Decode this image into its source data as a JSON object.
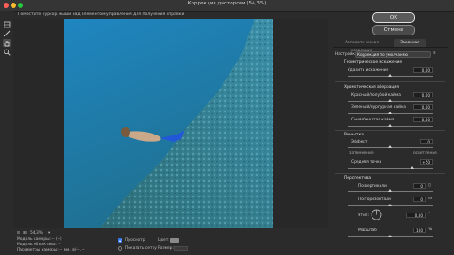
{
  "window": {
    "title": "Коррекция дисторсии (54,3%)"
  },
  "hint": "Поместите курсор мыши над элементом управления для получения справки",
  "buttons": {
    "ok": "ОК",
    "cancel": "Отмена"
  },
  "tabs": [
    {
      "label": "Автоматическая коррекция",
      "active": false
    },
    {
      "label": "Заказная",
      "active": true
    }
  ],
  "settings": {
    "label": "Настройки:",
    "value": "Коррекция по умолчанию"
  },
  "geometric": {
    "section": "Геометрическое искажение",
    "remove_distortion_label": "Удалить искажение",
    "remove_distortion_value": "0,00"
  },
  "chromatic": {
    "section": "Хроматическая аберрация",
    "items": [
      {
        "label": "Красный/голубой кайма",
        "value": "0,00"
      },
      {
        "label": "Зеленый/пурпурная кайма",
        "value": "0,00"
      },
      {
        "label": "Синяя/желтая кайма",
        "value": "0,00"
      }
    ]
  },
  "vignette": {
    "section": "Виньетка",
    "amount_label": "Эффект",
    "amount_value": "0",
    "darken_label": "затемнение",
    "lighten_label": "осветление",
    "midpoint_label": "Средняя точка",
    "midpoint_value": "+50"
  },
  "perspective": {
    "section": "Перспектива",
    "vertical_label": "По вертикали",
    "vertical_value": "0",
    "horizontal_label": "По горизонтали",
    "horizontal_value": "0",
    "angle_label": "Угол:",
    "angle_value": "0,00",
    "scale_label": "Масштаб",
    "scale_value": "100",
    "scale_unit": "%"
  },
  "zoom": {
    "value": "54,3%"
  },
  "camera_info": {
    "camera_model": "Модель камеры: -- (--)",
    "lens_model": "Модель объектива: --",
    "camera_settings": "Параметры камеры: -- мм, ф/--, --"
  },
  "options": {
    "preview_label": "Просмотр",
    "preview_checked": true,
    "show_grid_label": "Показать сетку",
    "show_grid_checked": false,
    "color_label": "Цвет:",
    "size_label": "Размер:"
  },
  "colors": {
    "accent": "#3478f6",
    "water_top": "#1f86c0",
    "water_bottom": "#1f6f8e",
    "fin": "#2257d8"
  }
}
